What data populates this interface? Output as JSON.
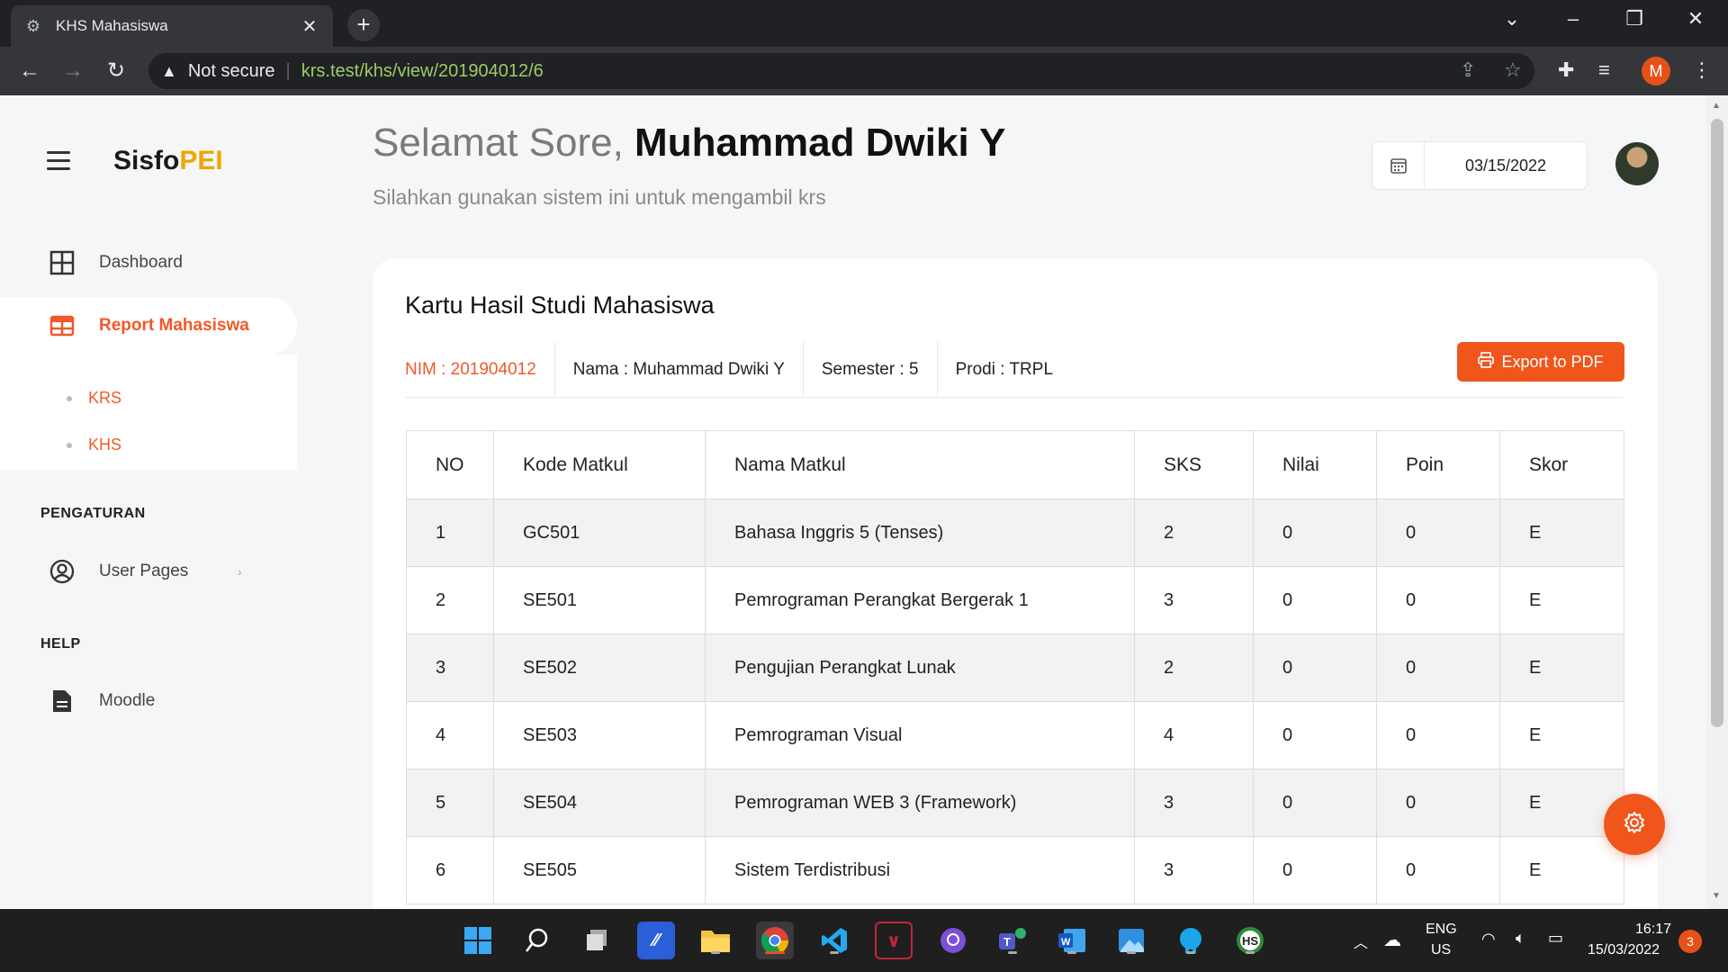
{
  "browser": {
    "tab_title": "KHS Mahasiswa",
    "security_label": "Not secure",
    "url": "krs.test/khs/view/201904012/6",
    "profile_initial": "M"
  },
  "sidebar": {
    "logo_main": "Sisfo",
    "logo_accent": "PEI",
    "items": [
      {
        "label": "Dashboard",
        "icon": "grid-icon"
      },
      {
        "label": "Report Mahasiswa",
        "icon": "table-icon"
      }
    ],
    "subitems": [
      {
        "label": "KRS"
      },
      {
        "label": "KHS"
      }
    ],
    "section_settings": "PENGATURAN",
    "user_pages": "User Pages",
    "section_help": "HELP",
    "moodle": "Moodle"
  },
  "header": {
    "greeting": "Selamat Sore,",
    "user_name": "Muhammad Dwiki Y",
    "subtitle": "Silahkan gunakan sistem ini untuk mengambil krs",
    "date": "03/15/2022"
  },
  "card": {
    "title": "Kartu Hasil Studi Mahasiswa",
    "nim": "NIM : 201904012",
    "nama": "Nama : Muhammad Dwiki Y",
    "semester": "Semester : 5",
    "prodi": "Prodi : TRPL",
    "export_label": "Export to PDF"
  },
  "table": {
    "headers": [
      "NO",
      "Kode Matkul",
      "Nama Matkul",
      "SKS",
      "Nilai",
      "Poin",
      "Skor"
    ],
    "rows": [
      [
        "1",
        "GC501",
        "Bahasa Inggris 5 (Tenses)",
        "2",
        "0",
        "0",
        "E"
      ],
      [
        "2",
        "SE501",
        "Pemrograman Perangkat Bergerak 1",
        "3",
        "0",
        "0",
        "E"
      ],
      [
        "3",
        "SE502",
        "Pengujian Perangkat Lunak",
        "2",
        "0",
        "0",
        "E"
      ],
      [
        "4",
        "SE503",
        "Pemrograman Visual",
        "4",
        "0",
        "0",
        "E"
      ],
      [
        "5",
        "SE504",
        "Pemrograman WEB 3 (Framework)",
        "3",
        "0",
        "0",
        "E"
      ],
      [
        "6",
        "SE505",
        "Sistem Terdistribusi",
        "3",
        "0",
        "0",
        "E"
      ]
    ]
  },
  "taskbar": {
    "lang_top": "ENG",
    "lang_bottom": "US",
    "time": "16:17",
    "date": "15/03/2022",
    "notifications": "3"
  },
  "colors": {
    "accent": "#f05a28",
    "logo_accent": "#f0a500"
  }
}
